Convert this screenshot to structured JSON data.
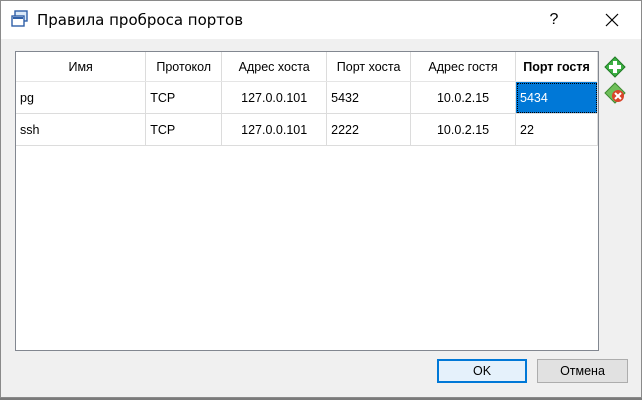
{
  "window": {
    "title": "Правила проброса портов",
    "help_label": "?"
  },
  "table": {
    "columns": [
      "Имя",
      "Протокол",
      "Адрес хоста",
      "Порт хоста",
      "Адрес гостя",
      "Порт гостя"
    ],
    "rows": [
      [
        "pg",
        "TCP",
        "127.0.0.101",
        "5432",
        "10.0.2.15",
        "5434"
      ],
      [
        "ssh",
        "TCP",
        "127.0.0.101",
        "2222",
        "10.0.2.15",
        "22"
      ]
    ]
  },
  "buttons": {
    "ok_label": "OK",
    "cancel_label": "Отмена"
  },
  "colors": {
    "selection": "#0078d7",
    "add_icon": "#3cb043",
    "remove_icon": "#d9442a"
  }
}
